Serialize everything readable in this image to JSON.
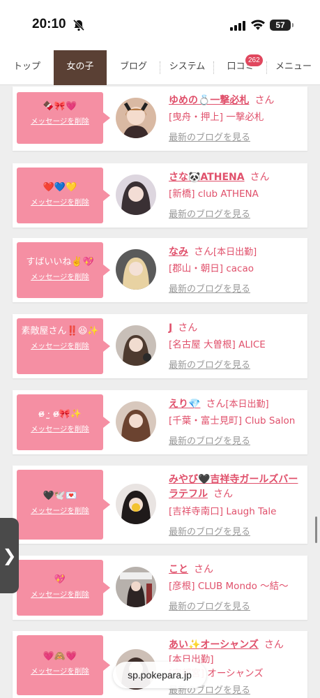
{
  "status": {
    "time": "20:10",
    "battery": "57"
  },
  "nav": {
    "tabs": [
      {
        "label": "トップ"
      },
      {
        "label": "女の子"
      },
      {
        "label": "ブログ"
      },
      {
        "label": "システム"
      },
      {
        "label": "口コミ"
      },
      {
        "label": "メニュー"
      }
    ],
    "review_badge": "262"
  },
  "delete_label": "メッセージを削除",
  "cards": [
    {
      "msg": "🍫🎀💗",
      "name": "ゆめの💍一撃必札",
      "san": "さん",
      "attend": "",
      "shop": "[曳舟・押上] 一撃必札",
      "blog": "最新のブログを見る"
    },
    {
      "msg": "❤️💙💛",
      "name": "さな🐼ATHENA",
      "san": "さん",
      "attend": "",
      "shop": "[新橋] club ATHENA",
      "blog": "最新のブログを見る"
    },
    {
      "msg": "すばいいね✌️💖",
      "name": "なみ",
      "san": "さん",
      "attend": "[本日出勤]",
      "shop": "[郡山・朝日] cacao",
      "blog": "最新のブログを見る"
    },
    {
      "msg": "素敵屋さん‼️😆✨",
      "name": "J",
      "san": "さん",
      "attend": "",
      "shop": "[名古屋 大曽根] ALICE",
      "blog": "最新のブログを見る"
    },
    {
      "msg": "ɞ̴̶̷ ·̫ ɞ̴̶̷🎀✨",
      "name": "えり💎",
      "san": "さん",
      "attend": "[本日出勤]",
      "shop": "[千葉・富士見町] Club Salon",
      "blog": "最新のブログを見る"
    },
    {
      "msg": "🖤🕊️💌",
      "name": "みやび🖤吉祥寺ガールズバーラテフル",
      "san": "さん",
      "attend": "",
      "shop": "[吉祥寺南口] Laugh Tale",
      "blog": "最新のブログを見る"
    },
    {
      "msg": "💖",
      "name": "こと",
      "san": "さん",
      "attend": "",
      "shop": "[彦根] CLUB Mondo 〜結〜",
      "blog": "最新のブログを見る"
    },
    {
      "msg": "💗🙈💗",
      "name": "あい✨オーシャンズ",
      "san": "さん",
      "attend": "[本日出勤]",
      "shop": "[宇都宮] オーシャンズ",
      "blog": "最新のブログを見る"
    }
  ],
  "side_tab": "❯",
  "url": "sp.pokepara.jp",
  "colors": {
    "accent": "#e0506b",
    "bubble": "#f58fa3",
    "nav_active": "#5a4034"
  }
}
